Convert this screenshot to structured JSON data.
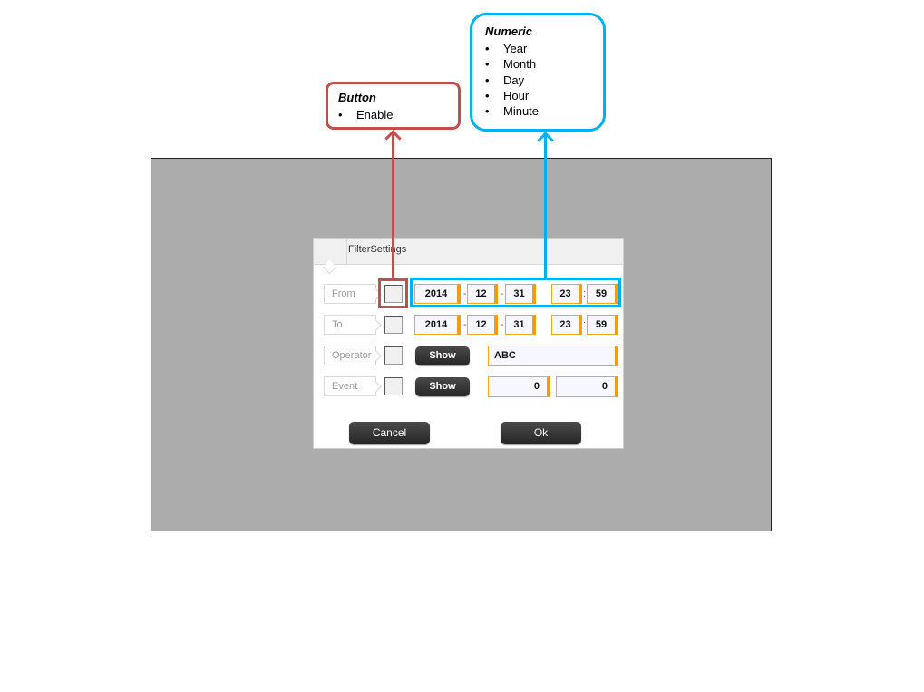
{
  "annotations": {
    "button_callout": {
      "title": "Button",
      "items": [
        "Enable"
      ],
      "color": "#c0504d"
    },
    "numeric_callout": {
      "title": "Numeric",
      "items": [
        "Year",
        "Month",
        "Day",
        "Hour",
        "Minute"
      ],
      "color": "#00b0f0"
    },
    "bullet": "•"
  },
  "dialog": {
    "title": "FilterSettings",
    "rows": [
      {
        "label": "From",
        "year": "2014",
        "month": "12",
        "day": "31",
        "hour": "23",
        "minute": "59"
      },
      {
        "label": "To",
        "year": "2014",
        "month": "12",
        "day": "31",
        "hour": "23",
        "minute": "59"
      },
      {
        "label": "Operator",
        "button": "Show",
        "value": "ABC"
      },
      {
        "label": "Event",
        "button": "Show",
        "value_a": "0",
        "value_b": "0"
      }
    ],
    "date_sep": "-",
    "time_sep": ":",
    "cancel_label": "Cancel",
    "ok_label": "Ok",
    "accent_color": "#f39c12"
  }
}
